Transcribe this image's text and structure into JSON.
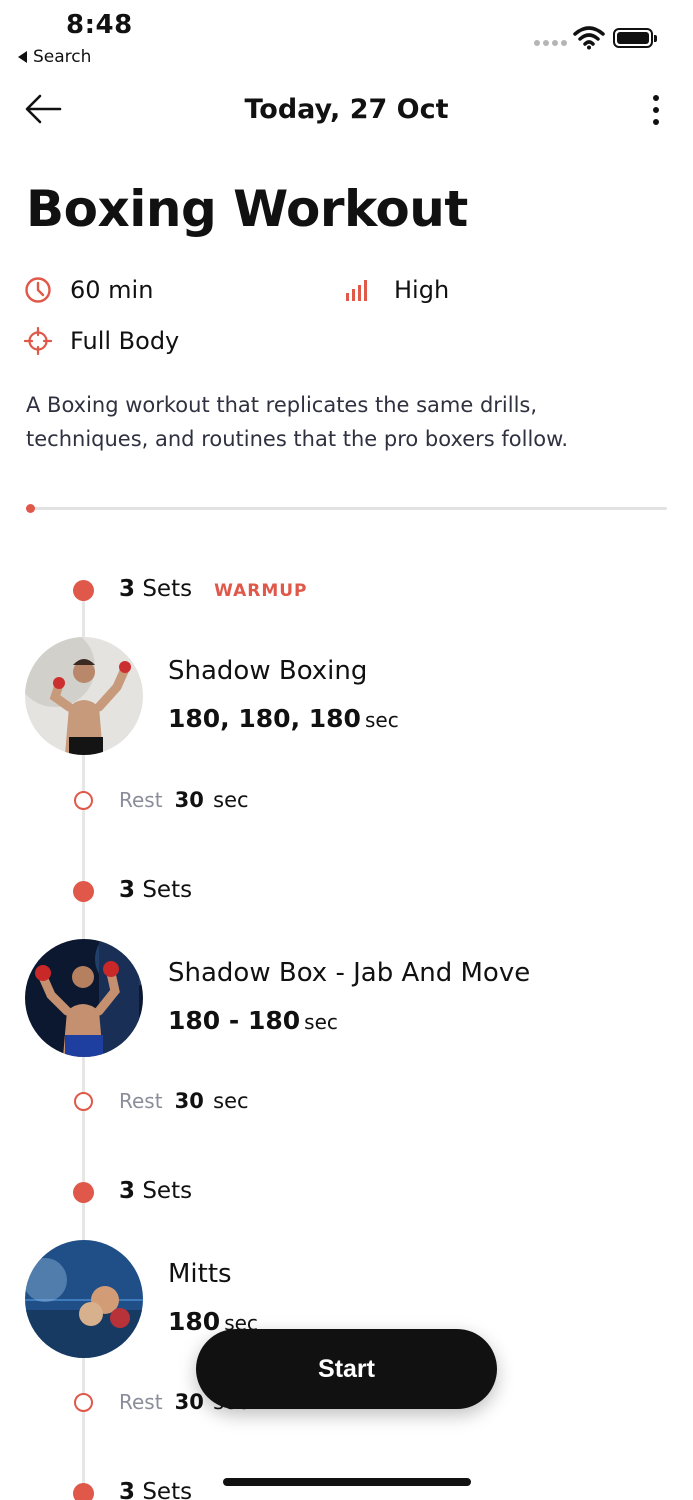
{
  "status_bar": {
    "time": "8:48",
    "back_label": "Search"
  },
  "nav": {
    "title": "Today, 27 Oct"
  },
  "workout": {
    "title": "Boxing Workout",
    "duration": "60 min",
    "intensity": "High",
    "target": "Full Body",
    "description": "A Boxing workout that replicates the same drills, techniques, and routines that the pro boxers follow.",
    "progress_fraction": 0
  },
  "exercises": [
    {
      "sets_count": "3",
      "sets_word": "Sets",
      "tag": "WARMUP",
      "name": "Shadow Boxing",
      "detail": "180, 180, 180",
      "unit": "sec",
      "rest_label": "Rest",
      "rest_value": "30",
      "rest_unit": "sec"
    },
    {
      "sets_count": "3",
      "sets_word": "Sets",
      "name": "Shadow Box - Jab And Move",
      "detail": "180 - 180",
      "unit": "sec",
      "rest_label": "Rest",
      "rest_value": "30",
      "rest_unit": "sec"
    },
    {
      "sets_count": "3",
      "sets_word": "Sets",
      "name": "Mitts",
      "detail": "180",
      "unit": "sec",
      "rest_label": "Rest",
      "rest_value": "30",
      "rest_unit": "sec"
    },
    {
      "sets_count": "3",
      "sets_word": "Sets"
    }
  ],
  "start_button": {
    "label": "Start"
  },
  "icons": {
    "back": "arrow-left-icon",
    "more": "more-vertical-icon",
    "duration": "clock-icon",
    "intensity": "signal-bars-icon",
    "target": "crosshair-icon"
  },
  "colors": {
    "accent": "#e0584a",
    "text": "#111111",
    "muted": "#8a8d9a",
    "button": "#111111"
  }
}
